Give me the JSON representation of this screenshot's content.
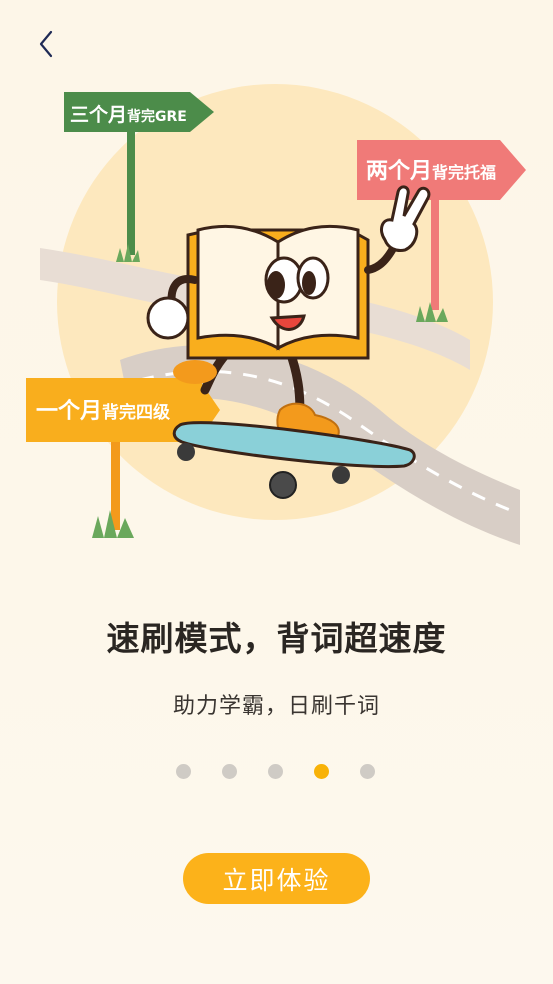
{
  "nav": {
    "back_icon": "chevron-left-icon"
  },
  "illustration": {
    "signs": [
      {
        "big": "三个月",
        "small": "背完GRE",
        "color": "#4c8c4a"
      },
      {
        "big": "两个月",
        "small": "背完托福",
        "color": "#f07a78"
      },
      {
        "big": "一个月",
        "small": "背完四级",
        "color": "#f9ae1d"
      }
    ]
  },
  "content": {
    "title": "速刷模式，背词超速度",
    "subtitle": "助力学霸，日刷千词"
  },
  "pager": {
    "count": 5,
    "active_index": 3
  },
  "cta": {
    "label": "立即体验"
  },
  "colors": {
    "accent": "#fcb21a",
    "background": "#fdf7ea",
    "dot_inactive": "#cfcbc5",
    "dot_active": "#f8b207"
  }
}
